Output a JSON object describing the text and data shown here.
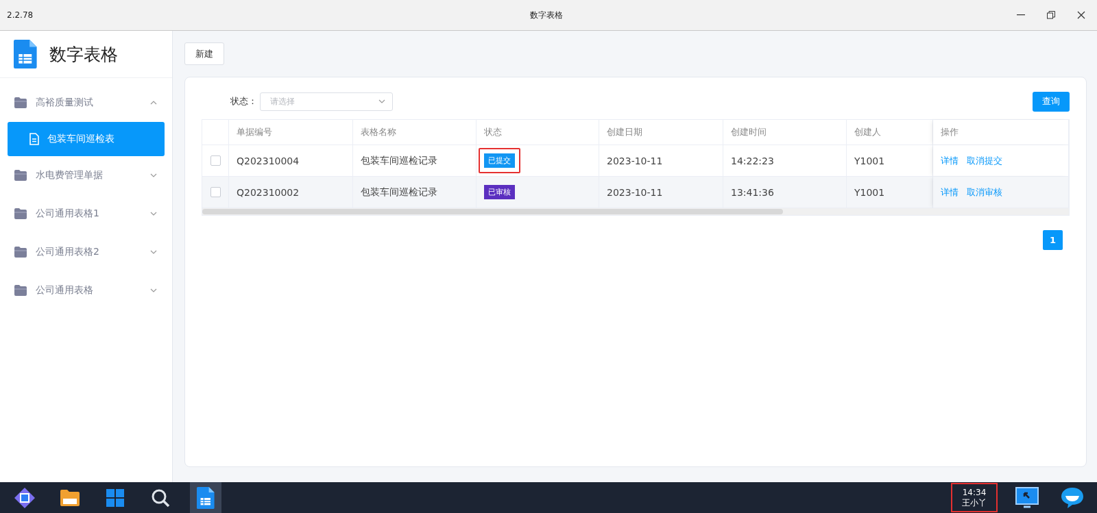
{
  "window": {
    "version": "2.2.78",
    "title": "数字表格"
  },
  "app": {
    "name": "数字表格"
  },
  "sidebar": {
    "items": [
      {
        "label": "高裕质量测试",
        "expanded": true,
        "children": [
          {
            "label": "包装车间巡检表",
            "selected": true
          }
        ]
      },
      {
        "label": "水电费管理单据",
        "expanded": false
      },
      {
        "label": "公司通用表格1",
        "expanded": false
      },
      {
        "label": "公司通用表格2",
        "expanded": false
      },
      {
        "label": "公司通用表格",
        "expanded": false
      }
    ]
  },
  "toolbar": {
    "new_button": "新建"
  },
  "filter": {
    "label": "状态：",
    "placeholder": "请选择",
    "query_button": "查询"
  },
  "table": {
    "columns": [
      "单据编号",
      "表格名称",
      "状态",
      "创建日期",
      "创建时间",
      "创建人",
      "操作"
    ],
    "rows": [
      {
        "checked": false,
        "id": "Q202310004",
        "name": "包装车间巡检记录",
        "status": {
          "text": "已提交",
          "color": "#1296f3",
          "highlighted": true
        },
        "date": "2023-10-11",
        "time": "14:22:23",
        "creator": "Y1001",
        "actions": [
          "详情",
          "取消提交"
        ]
      },
      {
        "checked": false,
        "id": "Q202310002",
        "name": "包装车间巡检记录",
        "status": {
          "text": "已审核",
          "color": "#5b2fc0",
          "highlighted": false
        },
        "date": "2023-10-11",
        "time": "13:41:36",
        "creator": "Y1001",
        "actions": [
          "详情",
          "取消审核"
        ]
      }
    ]
  },
  "pagination": {
    "pages": [
      {
        "label": "1",
        "selected": true
      }
    ]
  },
  "taskbar": {
    "clock": {
      "time": "14:34",
      "user": "王小丫",
      "highlighted": true
    }
  }
}
